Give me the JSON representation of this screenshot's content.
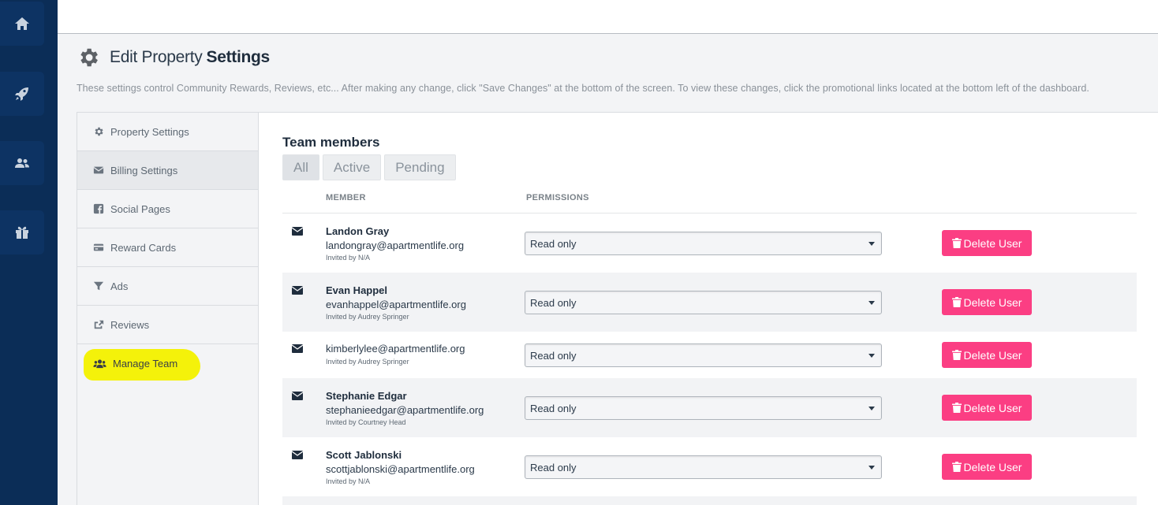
{
  "header": {
    "title_light": "Edit Property",
    "title_bold": "Settings",
    "description": "These settings control Community Rewards, Reviews, etc... After making any change, click \"Save Changes\" at the bottom of the screen. To view these changes, click the promotional links located at the bottom left of the dashboard."
  },
  "rail": {
    "items": [
      "home-icon",
      "rocket-icon",
      "users-icon",
      "gift-icon"
    ]
  },
  "nav": {
    "items": [
      {
        "label": "Property Settings",
        "icon": "gear-icon"
      },
      {
        "label": "Billing Settings",
        "icon": "envelope-icon"
      },
      {
        "label": "Social Pages",
        "icon": "facebook-icon"
      },
      {
        "label": "Reward Cards",
        "icon": "credit-card-icon"
      },
      {
        "label": "Ads",
        "icon": "filter-icon"
      },
      {
        "label": "Reviews",
        "icon": "share-icon"
      },
      {
        "label": "Manage Team",
        "icon": "users-icon"
      }
    ],
    "highlight_color": "#f4f20a"
  },
  "team": {
    "title": "Team members",
    "tabs": [
      "All",
      "Active",
      "Pending"
    ],
    "active_tab": "All",
    "col_member": "MEMBER",
    "col_permissions": "PERMISSIONS",
    "delete_label": "Delete User",
    "members": [
      {
        "name": "Landon Gray",
        "email": "landongray@apartmentlife.org",
        "invited": "Invited by N/A",
        "permission": "Read only"
      },
      {
        "name": "Evan Happel",
        "email": "evanhappel@apartmentlife.org",
        "invited": "Invited by Audrey Springer",
        "permission": "Read only"
      },
      {
        "name": "",
        "email": "kimberlylee@apartmentlife.org",
        "invited": "Invited by Audrey Springer",
        "permission": "Read only"
      },
      {
        "name": "Stephanie Edgar",
        "email": "stephanieedgar@apartmentlife.org",
        "invited": "Invited by Courtney Head",
        "permission": "Read only"
      },
      {
        "name": "Scott Jablonski",
        "email": "scottjablonski@apartmentlife.org",
        "invited": "Invited by N/A",
        "permission": "Read only"
      }
    ]
  },
  "colors": {
    "rail": "#0b2d57",
    "delete_button": "#fb3e83"
  }
}
